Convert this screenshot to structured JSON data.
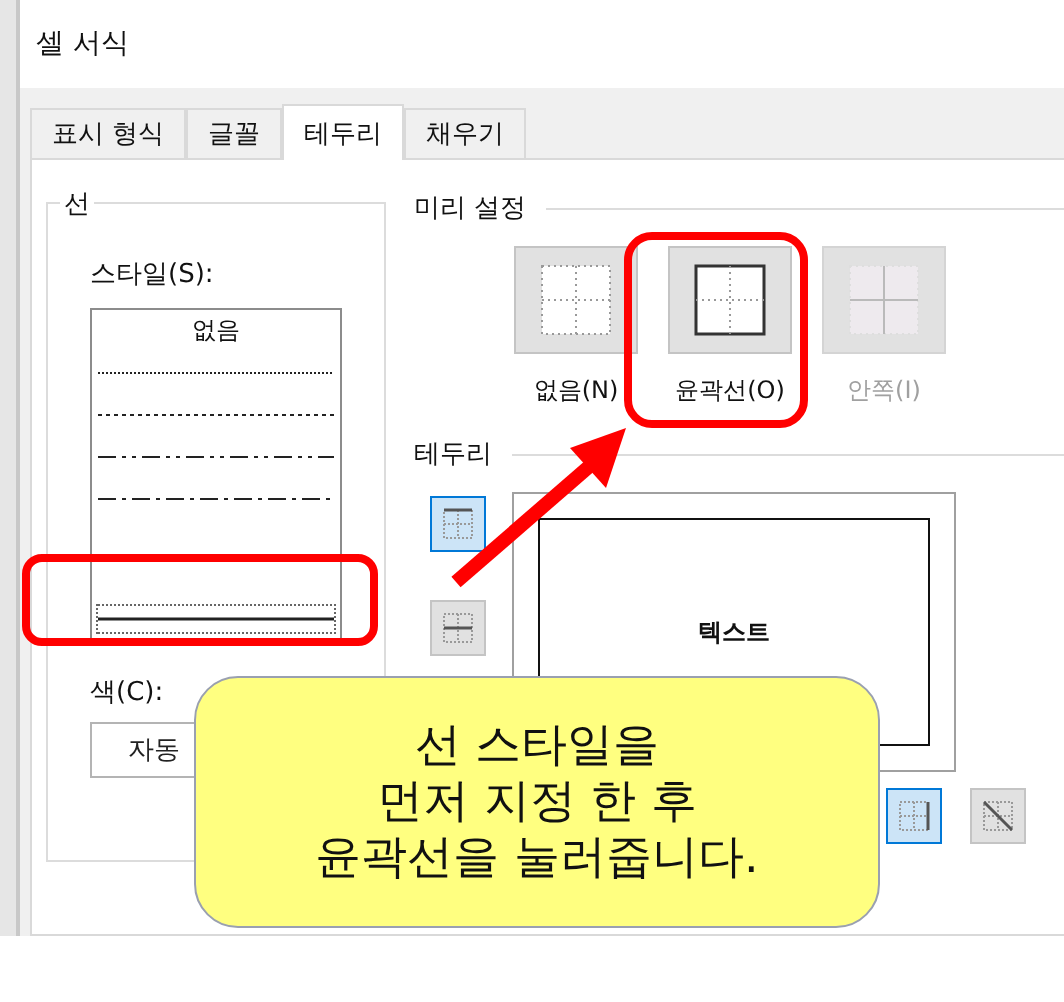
{
  "window": {
    "title": "셀 서식"
  },
  "tabs": [
    {
      "label": "표시 형식",
      "selected": false
    },
    {
      "label": "글꼴",
      "selected": false
    },
    {
      "label": "테두리",
      "selected": true
    },
    {
      "label": "채우기",
      "selected": false
    }
  ],
  "line": {
    "title": "선",
    "style_label": "스타일(S):",
    "styles": [
      {
        "kind": "none",
        "label": "없음",
        "selected": false
      },
      {
        "kind": "hair",
        "selected": false
      },
      {
        "kind": "dotted",
        "selected": false
      },
      {
        "kind": "dash_dot_dot",
        "selected": false
      },
      {
        "kind": "dash_dot",
        "selected": false
      },
      {
        "kind": "thin",
        "selected": true
      }
    ],
    "color_label": "색(C):",
    "color_value": "자동"
  },
  "presets": {
    "title": "미리 설정",
    "items": [
      {
        "kind": "none",
        "label": "없음(N)",
        "disabled": false
      },
      {
        "kind": "outline",
        "label": "윤곽선(O)",
        "disabled": false
      },
      {
        "kind": "inside",
        "label": "안쪽(I)",
        "disabled": true
      }
    ]
  },
  "border": {
    "title": "테두리",
    "preview_text": "텍스트",
    "side_buttons": [
      {
        "kind": "top",
        "on": true
      },
      {
        "kind": "middle",
        "on": false
      }
    ],
    "bottom_buttons": [
      {
        "kind": "right",
        "on": true
      },
      {
        "kind": "diag_down",
        "on": false
      }
    ]
  },
  "callout": {
    "lines": [
      "선 스타일을",
      "먼저 지정 한 후",
      "윤곽선을 눌러줍니다."
    ]
  }
}
